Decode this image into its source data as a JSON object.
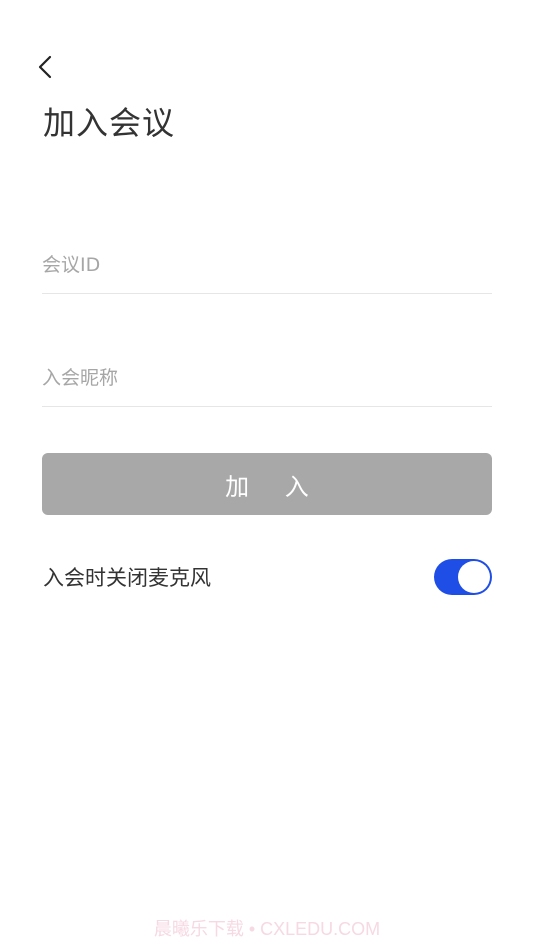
{
  "header": {
    "title": "加入会议",
    "back_icon": "chevron-left-icon"
  },
  "form": {
    "meeting_id": {
      "placeholder": "会议ID",
      "value": ""
    },
    "nickname": {
      "placeholder": "入会昵称",
      "value": ""
    },
    "join_label": "加 入",
    "join_enabled": false
  },
  "options": {
    "mute_mic_label": "入会时关闭麦克风",
    "mute_mic_on": true
  },
  "watermark": "晨曦乐下载 • CXLEDU.COM",
  "colors": {
    "accent": "#1f4ee6",
    "button_disabled": "#a8a8a8",
    "divider": "#e6e6e6",
    "placeholder": "#a6a6a6"
  }
}
